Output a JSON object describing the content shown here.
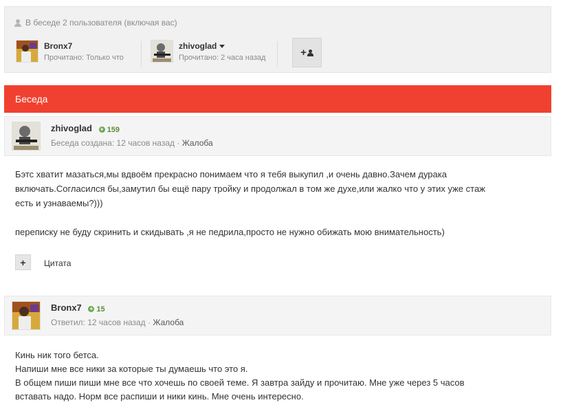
{
  "participants_panel": {
    "heading": "В беседе 2 пользователя (включая вас)",
    "participants": [
      {
        "name": "Bronx7",
        "status": "Прочитано: Только что"
      },
      {
        "name": "zhivoglad",
        "status": "Прочитано: 2 часа назад"
      }
    ],
    "invite_symbol": "+"
  },
  "conversation": {
    "title": "Беседа"
  },
  "messages": [
    {
      "author": "zhivoglad",
      "reputation": "159",
      "reputation_icon": "+",
      "meta_text": "Беседа создана: 12 часов назад",
      "separator": "·",
      "report_label": "Жалоба",
      "paragraphs": [
        "Бэтс хватит мазаться,мы вдвоём прекрасно понимаем что я тебя выкупил ,и очень давно.Зачем дурака включать.Согласился бы,замутил бы ещё пару тройку и продолжал в том же духе,или жалко что у этих уже стаж есть и узнаваемы?)))",
        "переписку не буду скринить и скидывать ,я не педрила,просто не нужно обижать мою внимательность)"
      ],
      "quote_symbol": "+",
      "quote_label": "Цитата"
    },
    {
      "author": "Bronx7",
      "reputation": "15",
      "reputation_icon": "+",
      "meta_text": "Ответил: 12 часов назад",
      "separator": "·",
      "report_label": "Жалоба",
      "lines": [
        "Кинь ник того бетса.",
        "Напиши мне все ники за которые ты думаешь что это я.",
        "В общем пиши пиши мне все что хочешь по своей теме. Я завтра зайду и прочитаю. Мне уже через 5 часов вставать надо. Норм все распиши и ники кинь. Мне очень интересно."
      ]
    }
  ],
  "colors": {
    "accent": "#f04130",
    "panel": "#f1f1f1",
    "muted": "#8a8a8a"
  }
}
